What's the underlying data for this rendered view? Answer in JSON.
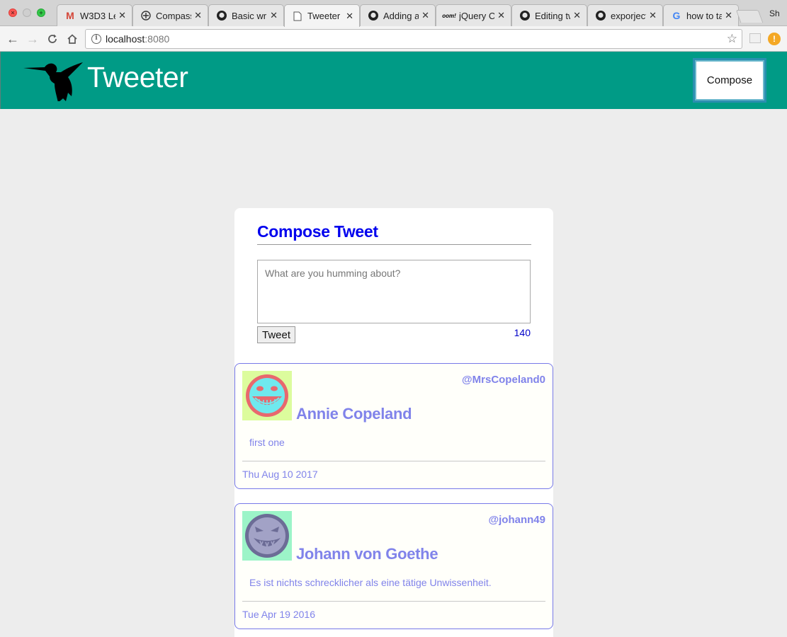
{
  "browser": {
    "tabs": [
      {
        "title": "W3D3 Le",
        "icon": "gmail-icon"
      },
      {
        "title": "Compass",
        "icon": "compass-icon"
      },
      {
        "title": "Basic writ",
        "icon": "github-icon"
      },
      {
        "title": "Tweeter",
        "icon": "page-icon"
      },
      {
        "title": "Adding ar",
        "icon": "github-icon"
      },
      {
        "title": "jQuery Cl",
        "icon": "jquery-icon"
      },
      {
        "title": "Editing tw",
        "icon": "github-icon"
      },
      {
        "title": "exporject",
        "icon": "github-icon"
      },
      {
        "title": "how to ta",
        "icon": "google-icon"
      }
    ],
    "active_tab": 3,
    "profile_label": "Sh",
    "url_host": "localhost",
    "url_port": ":8080"
  },
  "nav": {
    "brand": "Tweeter",
    "compose_label": "Compose"
  },
  "compose": {
    "title": "Compose Tweet",
    "placeholder": "What are you humming about?",
    "submit_label": "Tweet",
    "counter": "140"
  },
  "tweets": [
    {
      "handle": "@MrsCopeland0",
      "name": "Annie Copeland",
      "text": "first one",
      "date": "Thu Aug 10 2017",
      "avatar": {
        "bg": "#dcfc9d",
        "face": "#6fe9ee",
        "ring": "#e8686e",
        "icon": "grinning-face-icon"
      }
    },
    {
      "handle": "@johann49",
      "name": "Johann von Goethe",
      "text": "Es ist nichts schrecklicher als eine tätige Unwissenheit.",
      "date": "Tue Apr 19 2016",
      "avatar": {
        "bg": "#9cf4c8",
        "face": "#a2a2c6",
        "ring": "#6c6c96",
        "icon": "devilish-face-icon"
      }
    }
  ],
  "colors": {
    "nav_bg": "#009b86",
    "page_bg": "#ededed",
    "compose_title": "#0000ee",
    "tweet_accent": "#8083ea"
  }
}
